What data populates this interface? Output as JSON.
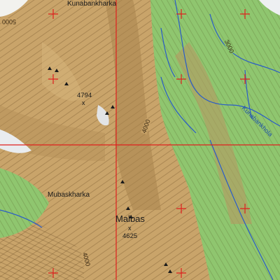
{
  "map": {
    "colors": {
      "terrain": "#c9a46a",
      "vegetation": "#8fc66f",
      "contour": "#6b4a22",
      "river": "#2a5cc8",
      "grid": "#e0201e",
      "snow": "#f2f2ee"
    },
    "places": {
      "kunabankharka": "Kunabankharka",
      "mubaskharka": "Mubaskharka",
      "malbas": "Malbas",
      "kunabankhola": "Kunabankhola"
    },
    "peaks": {
      "peak_4794": "4794",
      "peak_4625": "4625"
    },
    "peak_marker": "x",
    "contour_labels": {
      "top_left": "5000",
      "top_right": "3000",
      "center": "4000",
      "bottom": "4000"
    },
    "grid": {
      "crosshair": "crosshair",
      "tick": "plus"
    }
  }
}
